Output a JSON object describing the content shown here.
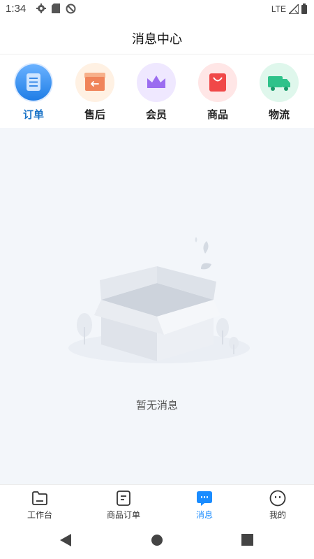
{
  "status": {
    "time": "1:34",
    "network": "LTE"
  },
  "header": {
    "title": "消息中心"
  },
  "categories": [
    {
      "label": "订单",
      "icon": "order-doc-icon",
      "active": true
    },
    {
      "label": "售后",
      "icon": "after-sale-box-icon",
      "active": false
    },
    {
      "label": "会员",
      "icon": "member-crown-icon",
      "active": false
    },
    {
      "label": "商品",
      "icon": "product-bag-icon",
      "active": false
    },
    {
      "label": "物流",
      "icon": "logistics-truck-icon",
      "active": false
    }
  ],
  "empty": {
    "text": "暂无消息"
  },
  "tabs": [
    {
      "label": "工作台",
      "icon": "folder-icon",
      "active": false
    },
    {
      "label": "商品订单",
      "icon": "order-list-icon",
      "active": false
    },
    {
      "label": "消息",
      "icon": "message-icon",
      "active": true
    },
    {
      "label": "我的",
      "icon": "profile-face-icon",
      "active": false
    }
  ],
  "colors": {
    "accent": "#1a73c7",
    "tab_active": "#1a8cff",
    "content_bg": "#f3f6fa"
  }
}
